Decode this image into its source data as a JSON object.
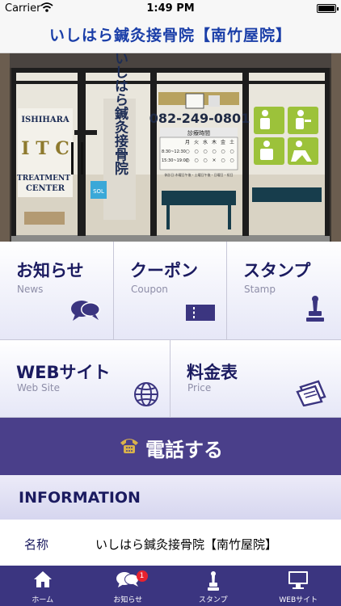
{
  "status_bar": {
    "carrier": "Carrier",
    "time": "1:49 PM",
    "battery_level": 1.0
  },
  "nav": {
    "title": "いしはら鍼灸接骨院【南竹屋院】"
  },
  "hero": {
    "sign_name": "ISHIHARA",
    "sign_letters": "I T C",
    "sign_sub1": "TREATMENT",
    "sign_sub2": "CENTER",
    "vertical_name": "いしはら鍼灸接骨院",
    "phone": "082-249-0801",
    "schedule_title": "診療時間",
    "schedule_days": [
      "月",
      "火",
      "水",
      "木",
      "金",
      "土"
    ],
    "schedule_rows": [
      {
        "time": "8:30~12:30",
        "marks": [
          "○",
          "○",
          "○",
          "○",
          "○",
          "○"
        ]
      },
      {
        "time": "15:30~19:00",
        "marks": [
          "○",
          "○",
          "○",
          "×",
          "○",
          "○"
        ]
      }
    ],
    "schedule_note": "休診日:木曜日午後・土曜日午後・日曜日・祝日",
    "sale_text": "SOL"
  },
  "menu": [
    {
      "jp": "お知らせ",
      "en": "News",
      "icon": "chat-bubbles-icon"
    },
    {
      "jp": "クーポン",
      "en": "Coupon",
      "icon": "ticket-icon"
    },
    {
      "jp": "スタンプ",
      "en": "Stamp",
      "icon": "stamp-icon"
    },
    {
      "jp": "WEBサイト",
      "en": "Web Site",
      "icon": "globe-icon"
    },
    {
      "jp": "料金表",
      "en": "Price",
      "icon": "price-list-icon"
    }
  ],
  "call": {
    "label": "電話する",
    "icon": "phone-icon"
  },
  "info": {
    "header": "INFORMATION",
    "rows": [
      {
        "key": "名称",
        "value": "いしはら鍼灸接骨院【南竹屋院】"
      }
    ]
  },
  "tabs": [
    {
      "label": "ホーム",
      "icon": "home-icon"
    },
    {
      "label": "お知らせ",
      "icon": "chat-bubbles-icon",
      "badge": "1"
    },
    {
      "label": "スタンプ",
      "icon": "stamp-icon"
    },
    {
      "label": "WEBサイト",
      "icon": "monitor-icon"
    }
  ],
  "colors": {
    "nav_title": "#1a3ea8",
    "tile_text": "#1b1b60",
    "call_bar": "#4a3f8a",
    "tab_bar": "#3b3580",
    "badge": "#e8222e",
    "pictogram_green": "#9cc23a"
  }
}
